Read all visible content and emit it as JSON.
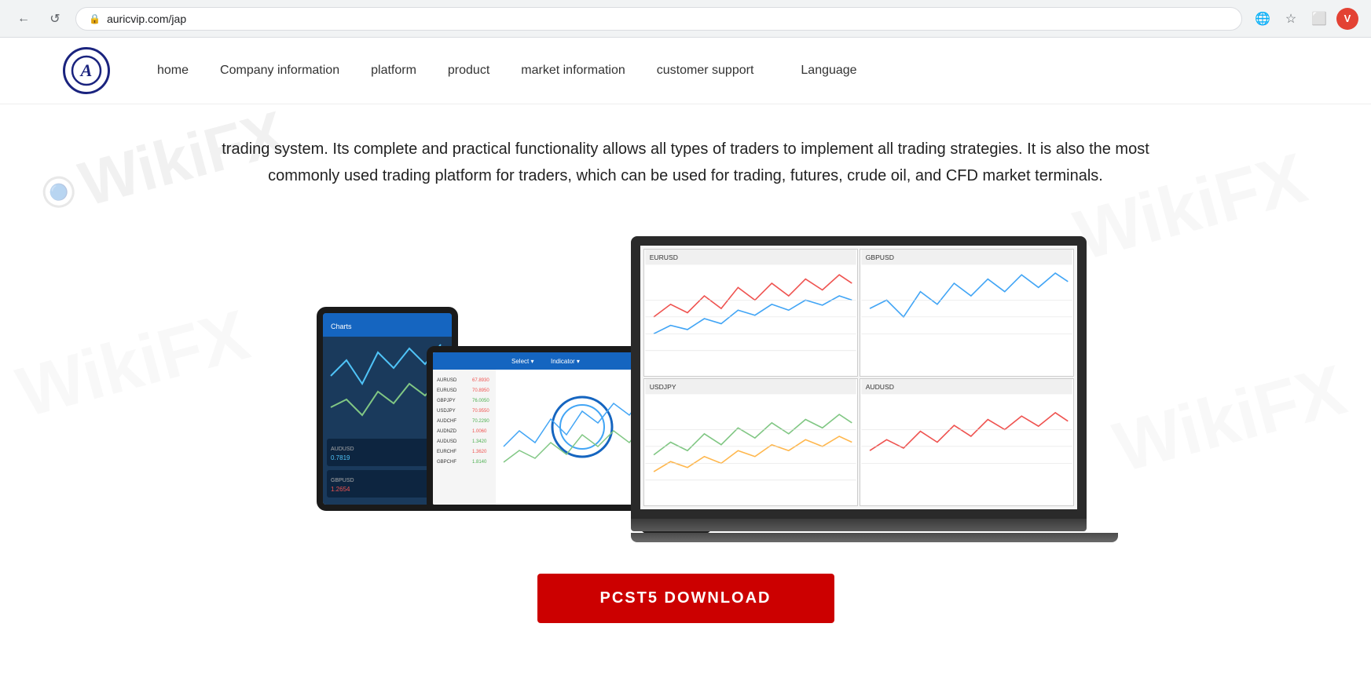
{
  "browser": {
    "back_btn": "←",
    "refresh_btn": "↺",
    "url": "auricvip.com/jap",
    "star_icon": "★",
    "extensions_icon": "⬜",
    "translate_icon": "🌐",
    "user_avatar_label": "V"
  },
  "header": {
    "logo_text": "A",
    "nav": {
      "home": "home",
      "company_information": "Company information",
      "platform": "platform",
      "product": "product",
      "market_information": "market information",
      "customer_support": "customer support",
      "language": "Language"
    }
  },
  "main": {
    "description": "trading system. Its complete and practical functionality allows all types of traders to implement all trading strategies. It is also the most commonly used trading platform for traders, which can be used for trading, futures, crude oil, and CFD market terminals.",
    "download_button": "PCST5 DOWNLOAD"
  },
  "watermark": {
    "text": "WikiFX"
  }
}
